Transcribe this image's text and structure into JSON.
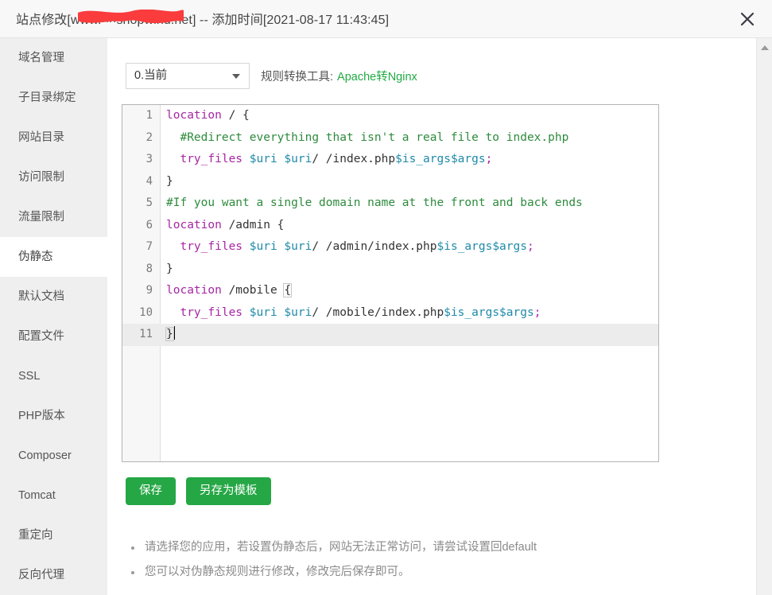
{
  "window": {
    "title_prefix": "站点修改[",
    "title_domain_visible": ".net] -- 添加时间[2021-08-17 11:43:45]",
    "title_full": "站点修改[www.××shopwind.net] -- 添加时间[2021-08-17 11:43:45]",
    "close_label": "×",
    "redaction_color": "#fa3c3c"
  },
  "sidebar": {
    "items": [
      {
        "label": "域名管理",
        "active": false
      },
      {
        "label": "子目录绑定",
        "active": false
      },
      {
        "label": "网站目录",
        "active": false
      },
      {
        "label": "访问限制",
        "active": false
      },
      {
        "label": "流量限制",
        "active": false
      },
      {
        "label": "伪静态",
        "active": true
      },
      {
        "label": "默认文档",
        "active": false
      },
      {
        "label": "配置文件",
        "active": false
      },
      {
        "label": "SSL",
        "active": false
      },
      {
        "label": "PHP版本",
        "active": false
      },
      {
        "label": "Composer",
        "active": false
      },
      {
        "label": "Tomcat",
        "active": false
      },
      {
        "label": "重定向",
        "active": false
      },
      {
        "label": "反向代理",
        "active": false
      }
    ]
  },
  "toolbar": {
    "select_value": "0.当前",
    "select_options": [
      "0.当前"
    ],
    "converter_label": "规则转换工具:",
    "converter_link": "Apache转Nginx",
    "link_color": "#22aa44"
  },
  "editor": {
    "active_line": 11,
    "lines": [
      {
        "n": 1,
        "tokens": [
          {
            "t": "kw",
            "v": "location"
          },
          {
            "t": "pun",
            "v": " / {"
          }
        ]
      },
      {
        "n": 2,
        "tokens": [
          {
            "t": "com",
            "v": "  #Redirect everything that isn't a real file to index.php"
          }
        ]
      },
      {
        "n": 3,
        "tokens": [
          {
            "t": "kw",
            "v": "  try_files "
          },
          {
            "t": "var",
            "v": "$uri"
          },
          {
            "t": "pun",
            "v": " "
          },
          {
            "t": "var",
            "v": "$uri"
          },
          {
            "t": "pun",
            "v": "/ /index.php"
          },
          {
            "t": "var",
            "v": "$is_args$args"
          },
          {
            "t": "kw",
            "v": ";"
          }
        ]
      },
      {
        "n": 4,
        "tokens": [
          {
            "t": "pun",
            "v": "}"
          }
        ]
      },
      {
        "n": 5,
        "tokens": [
          {
            "t": "com",
            "v": "#If you want a single domain name at the front and back ends"
          }
        ]
      },
      {
        "n": 6,
        "tokens": [
          {
            "t": "kw",
            "v": "location"
          },
          {
            "t": "pun",
            "v": " /admin {"
          }
        ]
      },
      {
        "n": 7,
        "tokens": [
          {
            "t": "kw",
            "v": "  try_files "
          },
          {
            "t": "var",
            "v": "$uri"
          },
          {
            "t": "pun",
            "v": " "
          },
          {
            "t": "var",
            "v": "$uri"
          },
          {
            "t": "pun",
            "v": "/ /admin/index.php"
          },
          {
            "t": "var",
            "v": "$is_args$args"
          },
          {
            "t": "kw",
            "v": ";"
          }
        ]
      },
      {
        "n": 8,
        "tokens": [
          {
            "t": "pun",
            "v": "}"
          }
        ]
      },
      {
        "n": 9,
        "tokens": [
          {
            "t": "kw",
            "v": "location"
          },
          {
            "t": "pun",
            "v": " /mobile "
          },
          {
            "t": "br",
            "v": "{"
          }
        ]
      },
      {
        "n": 10,
        "tokens": [
          {
            "t": "kw",
            "v": "  try_files "
          },
          {
            "t": "var",
            "v": "$uri"
          },
          {
            "t": "pun",
            "v": " "
          },
          {
            "t": "var",
            "v": "$uri"
          },
          {
            "t": "pun",
            "v": "/ /mobile/index.php"
          },
          {
            "t": "var",
            "v": "$is_args$args"
          },
          {
            "t": "kw",
            "v": ";"
          }
        ]
      },
      {
        "n": 11,
        "tokens": [
          {
            "t": "br",
            "v": "}"
          },
          {
            "t": "caret",
            "v": ""
          }
        ]
      }
    ],
    "plain_text": "location / {\n  #Redirect everything that isn't a real file to index.php\n  try_files $uri $uri/ /index.php$is_args$args;\n}\n#If you want a single domain name at the front and back ends\nlocation /admin {\n  try_files $uri $uri/ /admin/index.php$is_args$args;\n}\nlocation /mobile {\n  try_files $uri $uri/ /mobile/index.php$is_args$args;\n}"
  },
  "buttons": {
    "save": "保存",
    "save_as_template": "另存为模板",
    "color": "#26a745"
  },
  "notes": [
    "请选择您的应用，若设置伪静态后，网站无法正常访问，请尝试设置回default",
    "您可以对伪静态规则进行修改，修改完后保存即可。"
  ]
}
